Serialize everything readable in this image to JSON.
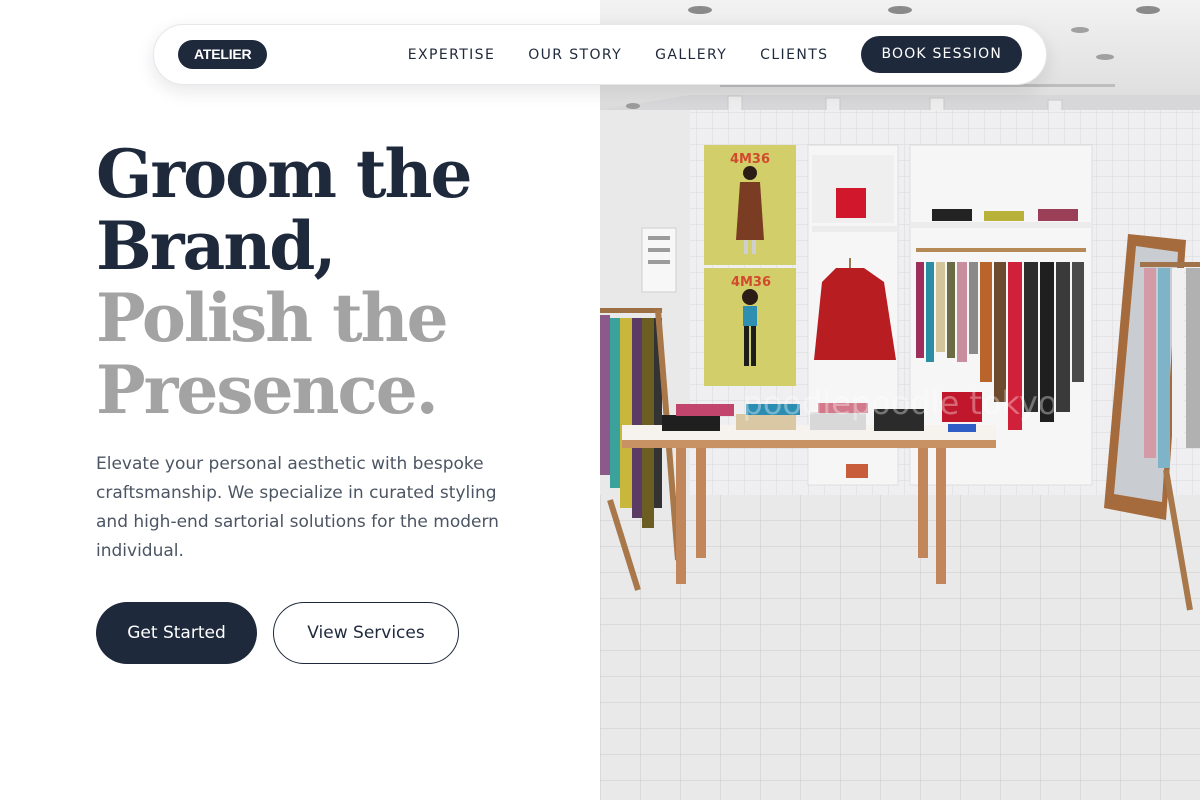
{
  "nav": {
    "logo": "ATELIER",
    "links": [
      "EXPERTISE",
      "OUR STORY",
      "GALLERY",
      "CLIENTS"
    ],
    "cta": "BOOK SESSION"
  },
  "hero": {
    "headline_dark_1": "Groom the",
    "headline_dark_2": "Brand,",
    "headline_muted_1": "Polish the",
    "headline_muted_2": "Presence.",
    "description": "Elevate your personal aesthetic with bespoke craftsmanship. We specialize in curated styling and high-end sartorial solutions for the modern individual.",
    "primary_button": "Get Started",
    "secondary_button": "View Services"
  },
  "image": {
    "poster_text_1": "4M36",
    "poster_text_2": "4M36",
    "watermark": "poodlepoodle tokyo"
  },
  "colors": {
    "navy": "#1e293b",
    "muted_headline": "#a3a3a3",
    "body_text": "#4b5563"
  }
}
